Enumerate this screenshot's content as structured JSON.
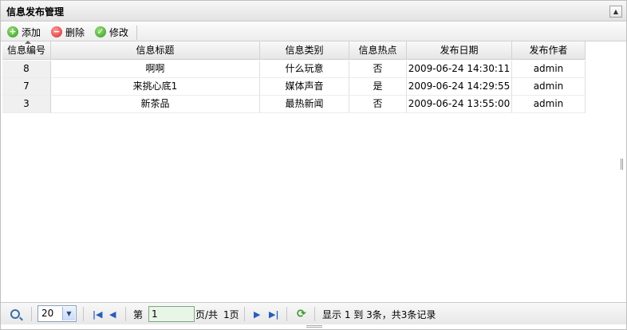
{
  "panel": {
    "title": "信息发布管理",
    "collapse_icon": "▲"
  },
  "toolbar": {
    "add_label": "添加",
    "delete_label": "删除",
    "edit_label": "修改"
  },
  "grid": {
    "columns": [
      "信息编号",
      "信息标题",
      "信息类别",
      "信息热点",
      "发布日期",
      "发布作者"
    ],
    "rows": [
      {
        "id": "8",
        "title": "啊啊",
        "category": "什么玩意",
        "hot": "否",
        "date": "2009-06-24 14:30:11",
        "author": "admin"
      },
      {
        "id": "7",
        "title": "来挑心底1",
        "category": "媒体声音",
        "hot": "是",
        "date": "2009-06-24 14:29:55",
        "author": "admin"
      },
      {
        "id": "3",
        "title": "新茶品",
        "category": "最热新闻",
        "hot": "否",
        "date": "2009-06-24 13:55:00",
        "author": "admin"
      }
    ]
  },
  "pager": {
    "page_size": "20",
    "page_prefix": "第",
    "current_page": "1",
    "page_suffix": "页/共",
    "total_pages": "1页",
    "display_info": "显示 1 到 3条，共3条记录",
    "first_icon": "|◀",
    "prev_icon": "◀",
    "next_icon": "▶",
    "last_icon": "▶|",
    "refresh_icon": "⟳"
  }
}
